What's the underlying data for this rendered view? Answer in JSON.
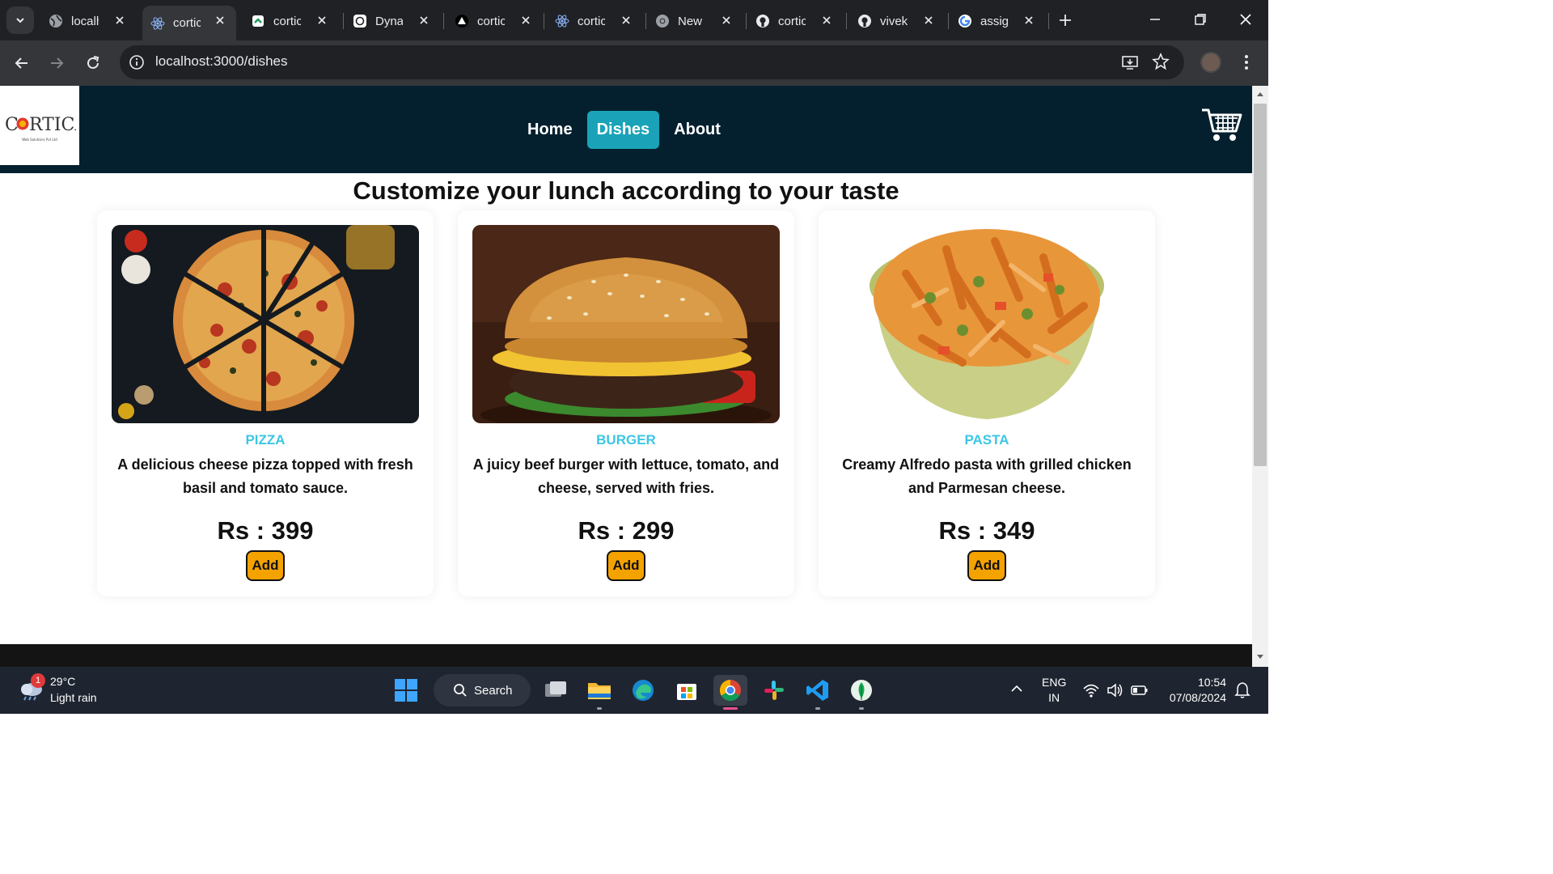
{
  "browser": {
    "tabs": [
      {
        "label": "localhost",
        "icon": "globe-icon",
        "active": false
      },
      {
        "label": "cortica",
        "icon": "react-icon",
        "active": true
      },
      {
        "label": "cortica",
        "icon": "codesandbox-icon",
        "active": false
      },
      {
        "label": "Dynamic",
        "icon": "chatgpt-icon",
        "active": false
      },
      {
        "label": "cortica",
        "icon": "vercel-icon",
        "active": false
      },
      {
        "label": "cortica",
        "icon": "react-icon",
        "active": false
      },
      {
        "label": "New Tab",
        "icon": "chrome-icon",
        "active": false
      },
      {
        "label": "cortica",
        "icon": "github-icon",
        "active": false
      },
      {
        "label": "vivekv",
        "icon": "github-icon",
        "active": false
      },
      {
        "label": "assignment",
        "icon": "google-icon",
        "active": false
      }
    ],
    "url": "localhost:3000/dishes"
  },
  "site": {
    "logo_text": "CORTICA",
    "logo_subtext": "Web Solutions Pvt Ltd",
    "nav": [
      {
        "label": "Home",
        "active": false
      },
      {
        "label": "Dishes",
        "active": true
      },
      {
        "label": "About",
        "active": false
      }
    ],
    "heading": "Customize your lunch according to your taste",
    "dishes": [
      {
        "name": "PIZZA",
        "description": "A delicious cheese pizza topped with fresh basil and tomato sauce.",
        "price": "Rs : 399",
        "button": "Add",
        "image": "pizza-image"
      },
      {
        "name": "BURGER",
        "description": "A juicy beef burger with lettuce, tomato, and cheese, served with fries.",
        "price": "Rs : 299",
        "button": "Add",
        "image": "burger-image"
      },
      {
        "name": "PASTA",
        "description": "Creamy Alfredo pasta with grilled chicken and Parmesan cheese.",
        "price": "Rs : 349",
        "button": "Add",
        "image": "pasta-image"
      }
    ],
    "colors": {
      "nav_bg": "#04202f",
      "active_link": "#1aa3b8",
      "dish_name": "#3cc6e6",
      "add_button": "#f4a200"
    }
  },
  "taskbar": {
    "weather_temp": "29°C",
    "weather_condition": "Light rain",
    "weather_badge": "1",
    "search_label": "Search",
    "lang_line1": "ENG",
    "lang_line2": "IN",
    "time": "10:54",
    "date": "07/08/2024"
  }
}
